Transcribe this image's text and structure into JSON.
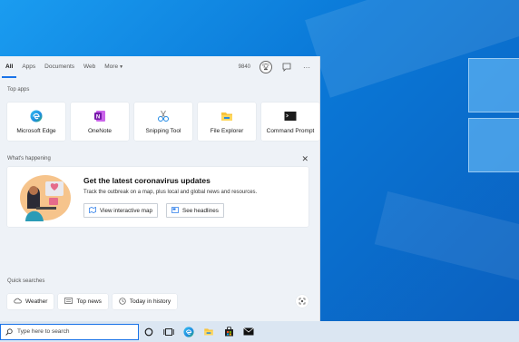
{
  "search_panel": {
    "tabs": [
      {
        "label": "All",
        "active": true
      },
      {
        "label": "Apps"
      },
      {
        "label": "Documents"
      },
      {
        "label": "Web"
      },
      {
        "label": "More"
      }
    ],
    "points": "9840",
    "top_apps_label": "Top apps",
    "top_apps": [
      {
        "label": "Microsoft Edge",
        "icon": "edge-icon"
      },
      {
        "label": "OneNote",
        "icon": "onenote-icon"
      },
      {
        "label": "Snipping Tool",
        "icon": "snipping-tool-icon"
      },
      {
        "label": "File Explorer",
        "icon": "file-explorer-icon"
      },
      {
        "label": "Command Prompt",
        "icon": "command-prompt-icon"
      }
    ],
    "whats_happening_label": "What's happening",
    "news": {
      "title": "Get the latest coronavirus updates",
      "description": "Track the outbreak on a map, plus local and global news and resources.",
      "map_button": "View interactive map",
      "headlines_button": "See headlines"
    },
    "quick_searches_label": "Quick searches",
    "quick_searches": [
      {
        "label": "Weather",
        "icon": "cloud-icon"
      },
      {
        "label": "Top news",
        "icon": "news-icon"
      },
      {
        "label": "Today in history",
        "icon": "clock-icon"
      }
    ]
  },
  "taskbar": {
    "search_placeholder": "Type here to search"
  },
  "colors": {
    "accent": "#1a73e8",
    "desktop": "#0a78d7",
    "panel": "#eef2f7"
  }
}
